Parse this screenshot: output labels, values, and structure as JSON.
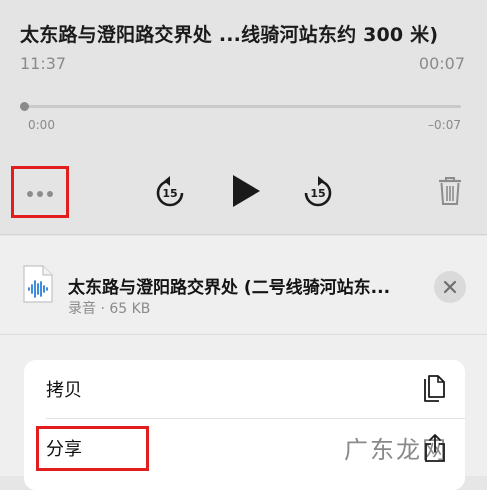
{
  "recording": {
    "title": "太东路与澄阳路交界处 ...线骑河站东约 300 米)",
    "date": "11:37",
    "duration": "00:07",
    "elapsed": "0:00",
    "remaining": "–0:07",
    "progress": 0
  },
  "controls": {
    "more_icon": "ellipsis-icon",
    "skip_back_icon": "skip-back-15-icon",
    "skip_back_label": "15",
    "play_icon": "play-icon",
    "skip_forward_icon": "skip-forward-15-icon",
    "skip_forward_label": "15",
    "delete_icon": "trash-icon"
  },
  "sheet": {
    "file_name": "太东路与澄阳路交界处 (二号线骑河站东...",
    "file_meta": "录音 · 65 KB",
    "file_icon": "audio-file-icon",
    "close_icon": "close-icon",
    "actions": [
      {
        "label": "拷贝",
        "icon": "copy-icon"
      },
      {
        "label": "分享",
        "icon": "share-icon"
      }
    ]
  },
  "watermark": "广东龙网",
  "colors": {
    "highlight": "#e11d1d",
    "accent": "#2a7fd8"
  }
}
